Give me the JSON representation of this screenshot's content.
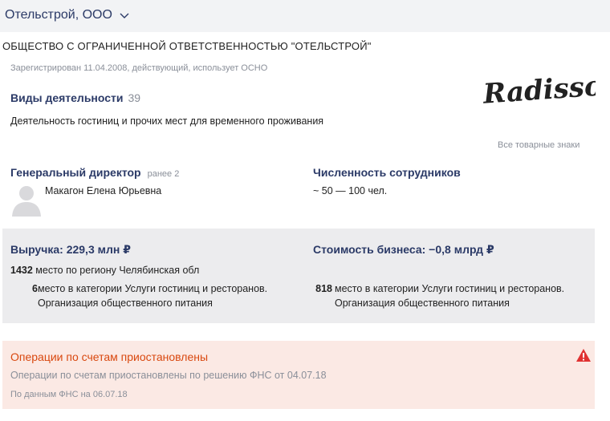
{
  "header": {
    "company_name": "Отельстрой, ООО",
    "dropdown_icon": "chevron-down-icon"
  },
  "company": {
    "full_name": "ОБЩЕСТВО С ОГРАНИЧЕННОЙ ОТВЕТСТВЕННОСТЬЮ \"ОТЕЛЬСТРОЙ\"",
    "registration_line": "Зарегистрирован 11.04.2008, действующий, использует ОСНО"
  },
  "logo": {
    "text": "Radisson"
  },
  "activities": {
    "title": "Виды деятельности",
    "count": "39",
    "main": "Деятельность гостиниц и прочих мест для временного проживания"
  },
  "trademarks": {
    "link": "Все товарные знаки"
  },
  "director": {
    "title": "Генеральный директор",
    "earlier": "ранее 2",
    "name": "Макагон Елена Юрьевна"
  },
  "employees": {
    "title": "Численность сотрудников",
    "value": "~ 50 — 100 чел."
  },
  "revenue": {
    "title": "Выручка: 229,3 млн ₽",
    "region_rank": "1432",
    "region_text": "место по региону Челябинская обл",
    "category_rank": "6",
    "category_text_1": "место в категории Услуги гостиниц и ресторанов.",
    "category_text_2": "Организация общественного питания"
  },
  "business_value": {
    "title": "Стоимость бизнеса: −0,8 млрд ₽",
    "category_rank": "818",
    "category_text_1": "место в категории Услуги гостиниц и ресторанов.",
    "category_text_2": "Организация общественного питания"
  },
  "alert": {
    "title": "Операции по счетам приостановлены",
    "text": "Операции по счетам приостановлены по решению ФНС от 04.07.18",
    "source": "По данным ФНС на 06.07.18",
    "icon": "warning-icon",
    "accent_color": "#d9480f"
  },
  "colors": {
    "primary": "#2b3a67",
    "muted": "#8a8f99",
    "stats_bg": "#ececee",
    "alert_bg": "#fbe9e4"
  }
}
